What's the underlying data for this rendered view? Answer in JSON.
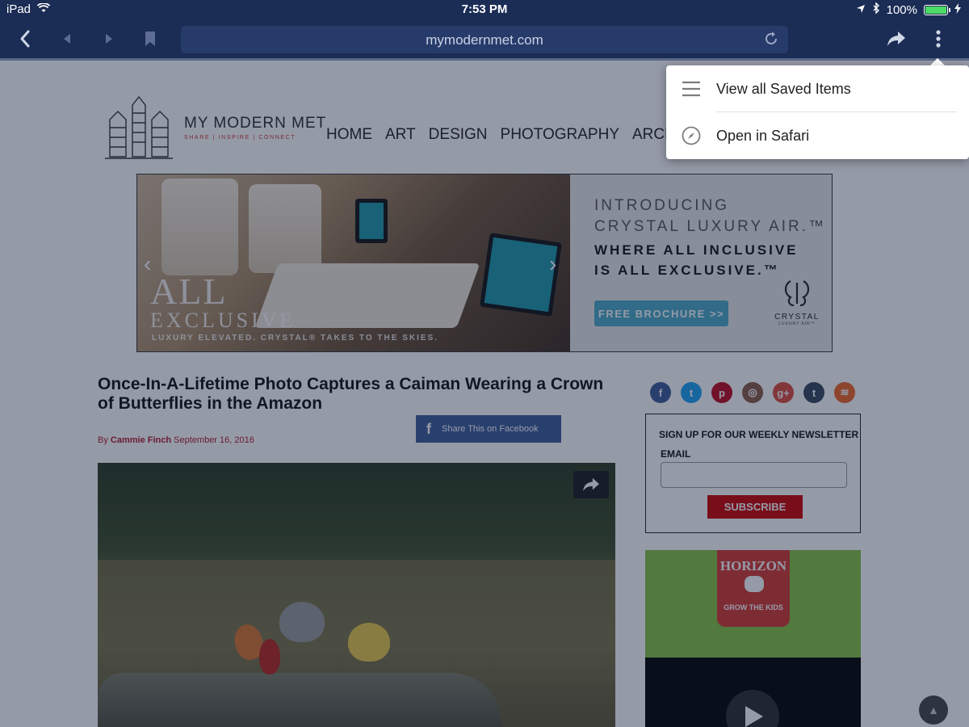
{
  "status_bar": {
    "device": "iPad",
    "time": "7:53 PM",
    "battery": "100%"
  },
  "toolbar": {
    "url": "mymodernmet.com",
    "icons": [
      "back-icon",
      "prev-icon",
      "next-icon",
      "bookmark-icon",
      "reload-icon",
      "share-icon",
      "more-vertical-icon"
    ]
  },
  "site": {
    "logo_name": "MY MODERN MET",
    "logo_tagline": "SHARE | INSPIRE | CONNECT",
    "nav": [
      "HOME",
      "ART",
      "DESIGN",
      "PHOTOGRAPHY",
      "ARCH"
    ]
  },
  "banner": {
    "headline_1": "ALL",
    "headline_2": "EXCLUSIVE",
    "caption": "LUXURY ELEVATED. CRYSTAL® TAKES TO THE SKIES.",
    "ad_line_1": "INTRODUCING",
    "ad_line_2": "CRYSTAL LUXURY AIR.™",
    "ad_line_3": "WHERE ALL INCLUSIVE",
    "ad_line_4": "IS ALL EXCLUSIVE.™",
    "ad_button": "FREE BROCHURE >>",
    "brand": "CRYSTAL",
    "brand_sub": "LUXURY AIR™"
  },
  "article": {
    "title": "Once-In-A-Lifetime Photo Captures a Caiman Wearing a Crown of Butterflies in the Amazon",
    "by": "By",
    "author": "Cammie Finch",
    "date": "September 16, 2016",
    "fb_share": "Share This on Facebook"
  },
  "sidebar": {
    "social": [
      {
        "icon": "facebook-icon",
        "glyph": "f",
        "color": "#3b5998"
      },
      {
        "icon": "twitter-icon",
        "glyph": "t",
        "color": "#1da1f2"
      },
      {
        "icon": "pinterest-icon",
        "glyph": "p",
        "color": "#bd081c"
      },
      {
        "icon": "instagram-icon",
        "glyph": "◎",
        "color": "#8a5a44"
      },
      {
        "icon": "google-plus-icon",
        "glyph": "g+",
        "color": "#dd4b39"
      },
      {
        "icon": "tumblr-icon",
        "glyph": "t",
        "color": "#35465c"
      },
      {
        "icon": "rss-icon",
        "glyph": "≋",
        "color": "#f26522"
      }
    ],
    "newsletter_heading": "SIGN UP FOR OUR WEEKLY NEWSLETTER",
    "email_label": "EMAIL",
    "email_value": "",
    "subscribe": "SUBSCRIBE",
    "ad_brand": "HORIZON",
    "ad_tagline": "GROW THE KIDS"
  },
  "menu": {
    "items": [
      {
        "label": "View all Saved Items",
        "icon": "list-icon"
      },
      {
        "label": "Open in Safari",
        "icon": "compass-icon"
      }
    ]
  }
}
